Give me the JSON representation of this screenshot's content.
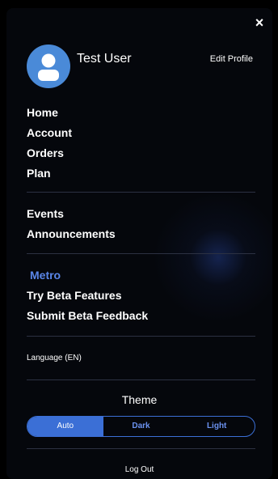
{
  "header": {
    "close_icon": "×"
  },
  "profile": {
    "name": "Test User",
    "edit_label": "Edit Profile",
    "avatar_icon": "user-avatar-icon"
  },
  "nav_primary": [
    {
      "label": "Home"
    },
    {
      "label": "Account"
    },
    {
      "label": "Orders"
    },
    {
      "label": "Plan"
    }
  ],
  "nav_secondary": [
    {
      "label": "Events"
    },
    {
      "label": "Announcements"
    }
  ],
  "nav_beta": [
    {
      "label": "Metro"
    },
    {
      "label": "Try Beta Features"
    },
    {
      "label": "Submit Beta Feedback"
    }
  ],
  "language": {
    "label": "Language (EN)"
  },
  "theme": {
    "title": "Theme",
    "options": [
      "Auto",
      "Dark",
      "Light"
    ],
    "selected": "Auto"
  },
  "footer": {
    "logout_label": "Log Out"
  },
  "colors": {
    "accent": "#3b6fd6",
    "metro": "#5a86e8",
    "avatar_bg": "#4a8ad8"
  }
}
